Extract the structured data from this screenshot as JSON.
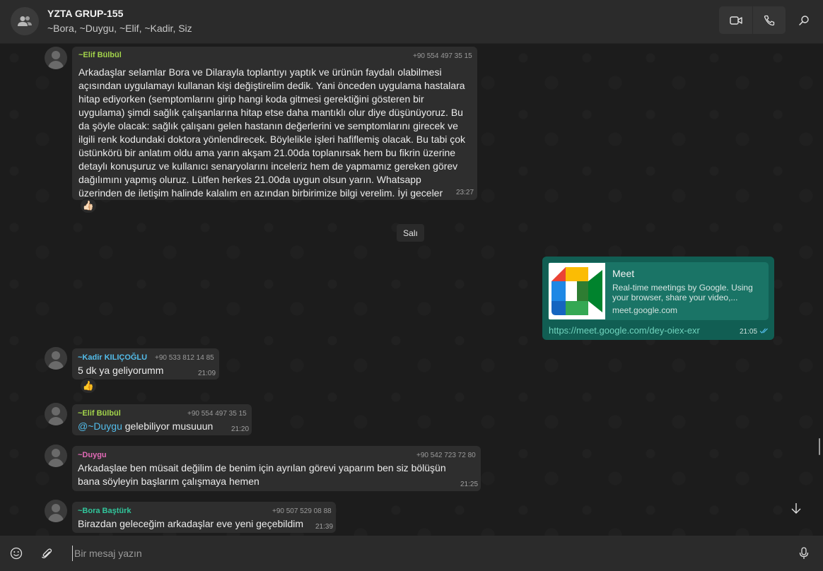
{
  "header": {
    "title": "YZTA GRUP-155",
    "members": "~Bora, ~Duygu, ~Elif, ~Kadir, Siz"
  },
  "messages": [
    {
      "sender": "~Elif Bülbül",
      "sender_color": "#a3d44b",
      "phone": "+90 554 497 35 15",
      "text": "Arkadaşlar selamlar Bora ve Dilarayla toplantıyı yaptık ve ürünün faydalı olabilmesi açısından uygulamayı kullanan kişi değiştirelim dedik. Yani önceden uygulama hastalara hitap ediyorken (semptomlarını girip hangi koda gitmesi gerektiğini gösteren bir uygulama) şimdi sağlık çalışanlarına hitap etse daha mantıklı olur diye düşünüyoruz. Bu da şöyle olacak: sağlık çalışanı gelen hastanın değerlerini ve semptomlarını girecek ve ilgili renk kodundaki doktora yönlendirecek. Böylelikle işleri hafiflemiş olacak. Bu tabi çok üstünkörü bir anlatım oldu ama yarın akşam 21.00da toplanırsak hem bu fikrin üzerine detaylı konuşuruz ve kullanıcı senaryolarını inceleriz hem de yapmamız gereken görev dağılımını yapmış oluruz. Lütfen herkes 21.00da uygun olsun yarın. Whatsapp üzerinden de iletişim halinde kalalım en azından birbirimize bilgi verelim. İyi geceler",
      "time": "23:27",
      "reaction": "👍🏻"
    },
    {
      "sender": "~Kadir KILIÇOĞLU",
      "sender_color": "#53bdeb",
      "phone": "+90 533 812 14 85",
      "text": "5 dk ya geliyorumm",
      "time": "21:09",
      "reaction": "👍"
    },
    {
      "sender": "~Elif Bülbül",
      "sender_color": "#a3d44b",
      "phone": "+90 554 497 35 15",
      "mention": "@~Duygu",
      "text": " gelebiliyor musuuun",
      "time": "21:20"
    },
    {
      "sender": "~Duygu",
      "sender_color": "#e26ab6",
      "phone": "+90 542 723 72 80",
      "text": "Arkadaşlae ben müsait değilim de benim için ayrılan görevi yaparım ben siz bölüşün bana söyleyin başlarım çalışmaya hemen",
      "time": "21:25"
    },
    {
      "sender": "~Bora Baştürk",
      "sender_color": "#31c59b",
      "phone": "+90 507 529 08 88",
      "text": "Birazdan geleceğim arkadaşlar eve yeni geçebildim",
      "time": "21:39"
    }
  ],
  "day_separator": "Salı",
  "outgoing_link": {
    "title": "Meet",
    "description": "Real-time meetings by Google. Using your browser, share your video,...",
    "domain": "meet.google.com",
    "url": "https://meet.google.com/dey-oiex-exr",
    "time": "21:05",
    "status": "read"
  },
  "composer": {
    "placeholder": "Bir mesaj yazın"
  },
  "icons": {
    "group_avatar": "group-icon",
    "video_call": "video-camera-icon",
    "voice_call": "phone-icon",
    "search": "search-icon",
    "scroll_down": "arrow-down-icon",
    "emoji": "smiley-icon",
    "attach": "paperclip-icon",
    "mic": "microphone-icon"
  },
  "colors": {
    "header_bg": "#2b2b2b",
    "chat_bg": "#1c1c1c",
    "incoming_bubble": "#2e2e2e",
    "outgoing_bubble": "#115e53",
    "link_color": "#6fd3bd",
    "read_ticks": "#53bdeb"
  }
}
